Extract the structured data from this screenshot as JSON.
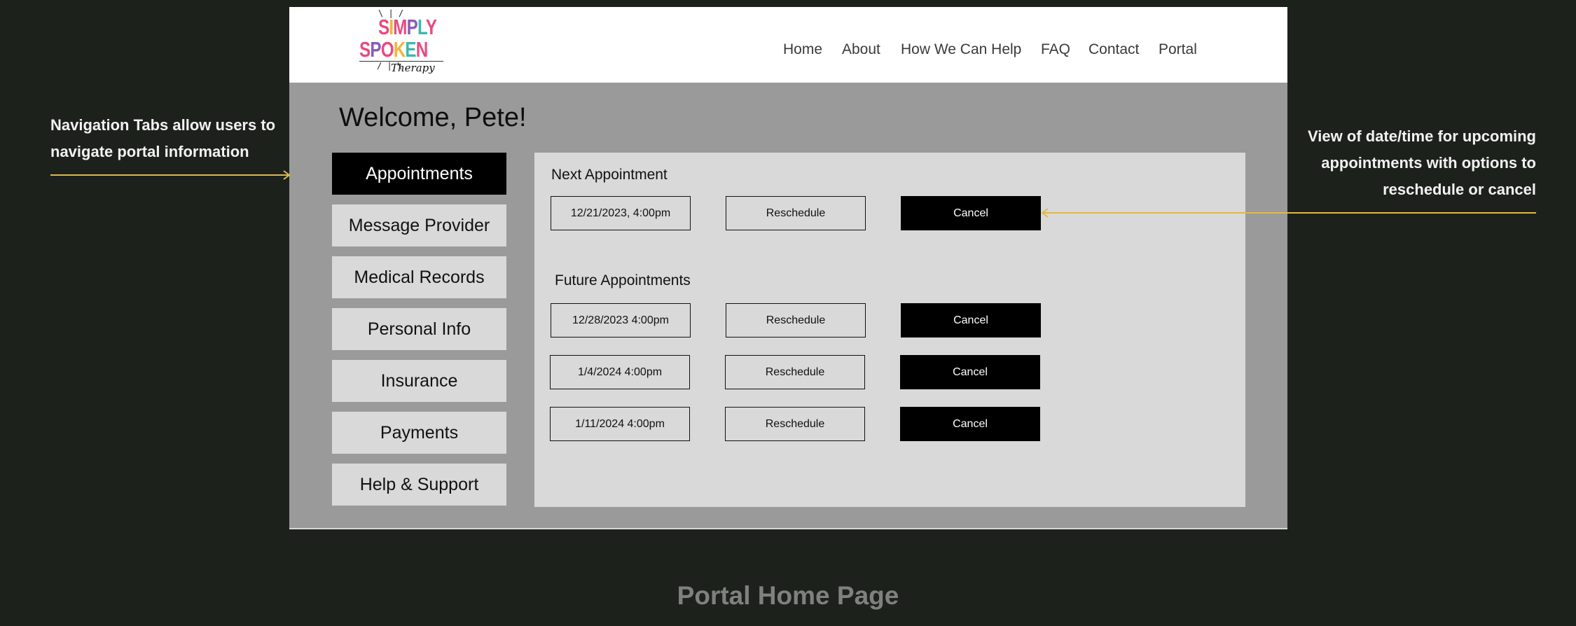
{
  "logo": {
    "line1": "SIMPLY",
    "line2": "SPOKEN",
    "line3": "Therapy",
    "colors": [
      "#e94a7f",
      "#f2b43f",
      "#3fb7b0",
      "#8a5bb5"
    ]
  },
  "nav": {
    "items": [
      {
        "label": "Home"
      },
      {
        "label": "About"
      },
      {
        "label": "How We Can Help"
      },
      {
        "label": "FAQ"
      },
      {
        "label": "Contact"
      },
      {
        "label": "Portal"
      }
    ]
  },
  "welcome": "Welcome, Pete!",
  "tabs": [
    {
      "label": "Appointments",
      "active": true
    },
    {
      "label": "Message Provider"
    },
    {
      "label": "Medical Records"
    },
    {
      "label": "Personal Info"
    },
    {
      "label": "Insurance"
    },
    {
      "label": "Payments"
    },
    {
      "label": "Help & Support"
    }
  ],
  "next_appointment": {
    "heading": "Next Appointment",
    "date": "12/21/2023, 4:00pm",
    "reschedule_label": "Reschedule",
    "cancel_label": "Cancel"
  },
  "future_appointments": {
    "heading": "Future Appointments",
    "rows": [
      {
        "date": "12/28/2023 4:00pm",
        "reschedule_label": "Reschedule",
        "cancel_label": "Cancel"
      },
      {
        "date": "1/4/2024 4:00pm",
        "reschedule_label": "Reschedule",
        "cancel_label": "Cancel"
      },
      {
        "date": "1/11/2024 4:00pm",
        "reschedule_label": "Reschedule",
        "cancel_label": "Cancel"
      }
    ]
  },
  "annotations": {
    "left_line1": "Navigation Tabs allow users to",
    "left_line2": "navigate portal information",
    "right_line1": "View of date/time for upcoming",
    "right_line2": "appointments with options to",
    "right_line3": "reschedule or cancel"
  },
  "footer_title": "Portal Home Page",
  "colors": {
    "background": "#1d211c",
    "frame": "#9a9a9a",
    "panel": "#d9d9d9",
    "accent_arrow": "#e0b94f",
    "footer_text": "#808080"
  }
}
